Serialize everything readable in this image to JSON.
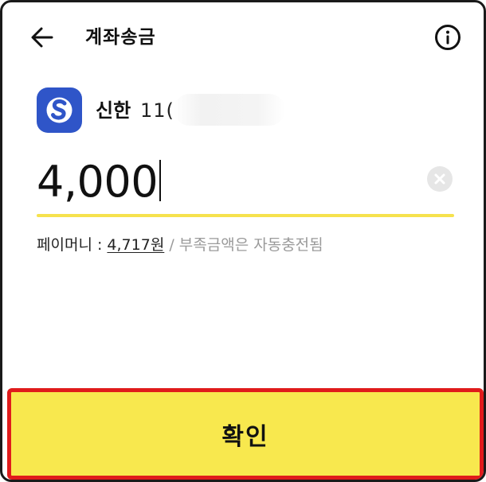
{
  "header": {
    "title": "계좌송금",
    "back_icon": "arrow-left-icon",
    "info_icon": "info-circle-icon"
  },
  "account": {
    "bank_name": "신한",
    "number_visible": "11(",
    "logo_color": "#2f55c8"
  },
  "amount": {
    "value": "4,000"
  },
  "balance": {
    "label": "페이머니 :",
    "amount": "4,717원",
    "separator": "/",
    "note": "부족금액은 자동충전됨"
  },
  "confirm": {
    "label": "확인",
    "bg_color": "#f8e84e",
    "highlight_color": "#e01b1b"
  },
  "colors": {
    "accent_underline": "#f6e24d"
  }
}
